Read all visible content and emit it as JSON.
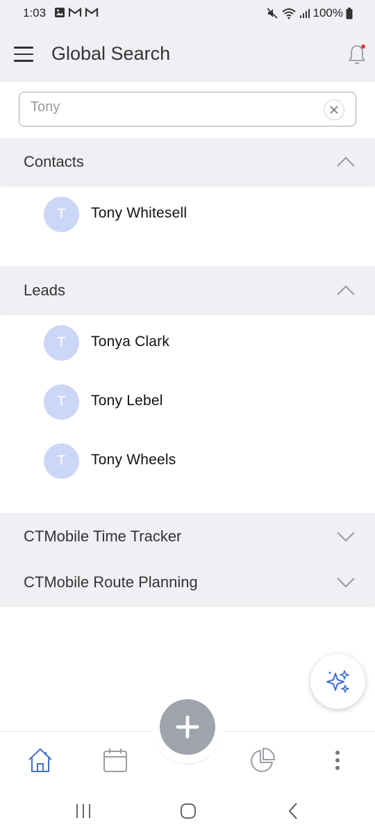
{
  "status": {
    "time": "1:03",
    "battery": "100%",
    "left_icons": [
      "image-icon",
      "gmail-icon",
      "gmail-icon"
    ],
    "right_icons": [
      "mute-icon",
      "wifi-icon",
      "signal-icon",
      "battery-icon"
    ]
  },
  "header": {
    "title": "Global Search",
    "menu_icon": "hamburger-menu-icon",
    "bell_icon": "bell-icon",
    "notification_dot_color": "#e53935"
  },
  "search": {
    "value": "Tony",
    "clear_icon": "clear-icon"
  },
  "sections": {
    "contacts": {
      "title": "Contacts",
      "expanded": true,
      "items": [
        {
          "initial": "T",
          "name": "Tony Whitesell"
        }
      ]
    },
    "leads": {
      "title": "Leads",
      "expanded": true,
      "items": [
        {
          "initial": "T",
          "name": "Tonya Clark"
        },
        {
          "initial": "T",
          "name": "Tony Lebel"
        },
        {
          "initial": "T",
          "name": "Tony Wheels"
        }
      ]
    },
    "time_tracker": {
      "title": "CTMobile Time Tracker",
      "expanded": false
    },
    "route_planning": {
      "title": "CTMobile Route Planning",
      "expanded": false
    }
  },
  "bottom_nav": {
    "items": [
      "home-icon",
      "calendar-icon",
      "add-icon",
      "pie-chart-icon",
      "more-vertical-icon"
    ],
    "active_color": "#3f6fd1"
  },
  "ai_fab": {
    "icon": "sparkles-icon",
    "color": "#3f6fd1"
  },
  "colors": {
    "header_bg": "#eff0f4",
    "avatar_bg": "#ccd6f6",
    "fab_bg": "#9fa3ac"
  }
}
